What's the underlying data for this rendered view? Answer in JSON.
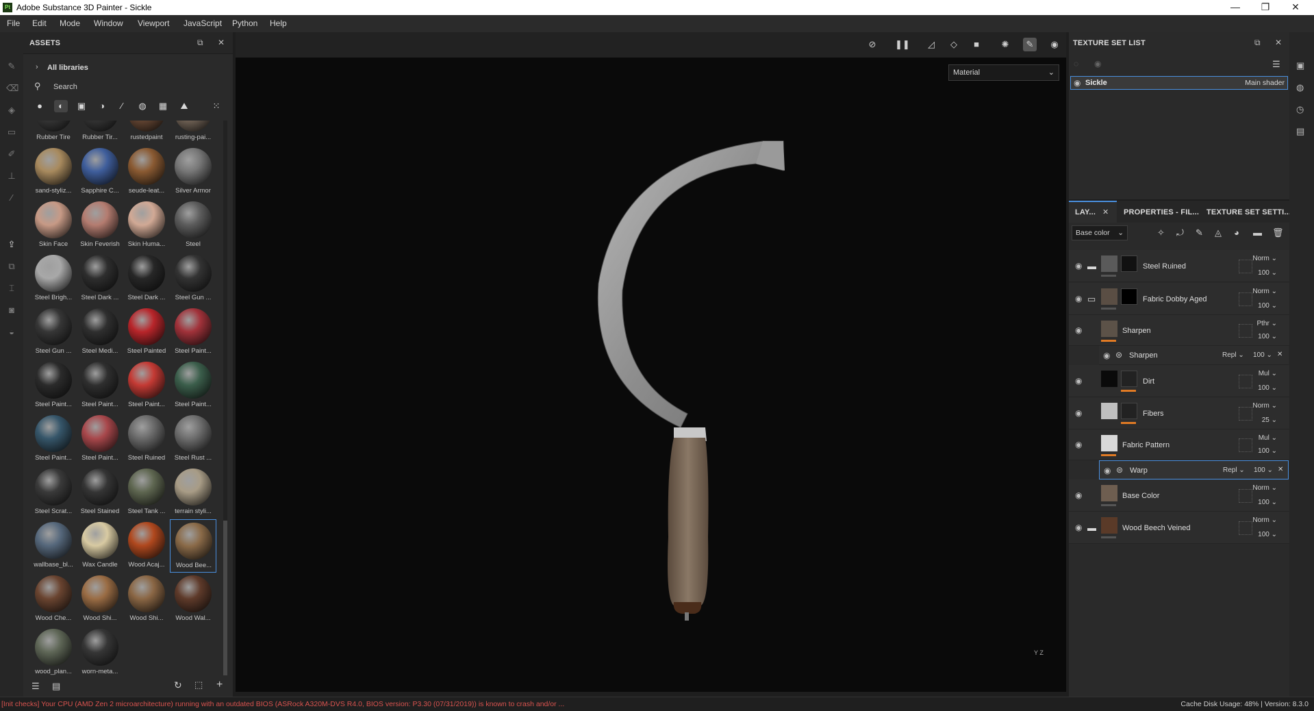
{
  "window": {
    "title": "Adobe Substance 3D Painter - Sickle",
    "app_icon": "Pt"
  },
  "menu": [
    "File",
    "Edit",
    "Mode",
    "Window",
    "Viewport",
    "JavaScript",
    "Python",
    "Help"
  ],
  "assets": {
    "title": "ASSETS",
    "library": "All libraries",
    "search_placeholder": "Search",
    "items": [
      {
        "label": "Rubber Tire",
        "color": "#3a3a3a"
      },
      {
        "label": "Rubber Tir...",
        "color": "#383838"
      },
      {
        "label": "rustedpaint",
        "color": "#6b4a36"
      },
      {
        "label": "rusting-pai...",
        "color": "#7a6a5c"
      },
      {
        "label": "sand-styliz...",
        "color": "#a88a5e"
      },
      {
        "label": "Sapphire C...",
        "color": "#3f5e9c"
      },
      {
        "label": "seude-leat...",
        "color": "#8a5a32"
      },
      {
        "label": "Silver Armor",
        "color": "#777777"
      },
      {
        "label": "Skin Face",
        "color": "#c79a86"
      },
      {
        "label": "Skin Feverish",
        "color": "#b47c70"
      },
      {
        "label": "Skin Huma...",
        "color": "#d1a995"
      },
      {
        "label": "Steel",
        "color": "#5c5c5c"
      },
      {
        "label": "Steel Brigh...",
        "color": "#a8a8a8"
      },
      {
        "label": "Steel Dark ...",
        "color": "#2e2e2e"
      },
      {
        "label": "Steel Dark ...",
        "color": "#272727"
      },
      {
        "label": "Steel Gun ...",
        "color": "#333333"
      },
      {
        "label": "Steel Gun ...",
        "color": "#363636"
      },
      {
        "label": "Steel Medi...",
        "color": "#2f2f2f"
      },
      {
        "label": "Steel Painted",
        "color": "#b8252a"
      },
      {
        "label": "Steel Paint...",
        "color": "#a1323a"
      },
      {
        "label": "Steel Paint...",
        "color": "#2b2b2b"
      },
      {
        "label": "Steel Paint...",
        "color": "#2f2f2f"
      },
      {
        "label": "Steel Paint...",
        "color": "#c43a34"
      },
      {
        "label": "Steel Paint...",
        "color": "#3b5e4b"
      },
      {
        "label": "Steel Paint...",
        "color": "#36566a"
      },
      {
        "label": "Steel Paint...",
        "color": "#a8474b"
      },
      {
        "label": "Steel Ruined",
        "color": "#6a6a6a"
      },
      {
        "label": "Steel Rust ...",
        "color": "#6e6e6e"
      },
      {
        "label": "Steel Scrat...",
        "color": "#3a3a3a"
      },
      {
        "label": "Steel Stained",
        "color": "#353535"
      },
      {
        "label": "Steel Tank ...",
        "color": "#5e6650"
      },
      {
        "label": "terrain styli...",
        "color": "#a89c86"
      },
      {
        "label": "wallbase_bl...",
        "color": "#56687c"
      },
      {
        "label": "Wax Candle",
        "color": "#d8caa2"
      },
      {
        "label": "Wood Acaj...",
        "color": "#b0481e"
      },
      {
        "label": "Wood Bee...",
        "color": "#8a6a48"
      },
      {
        "label": "Wood Che...",
        "color": "#6a4430"
      },
      {
        "label": "Wood Shi...",
        "color": "#9a6c44"
      },
      {
        "label": "Wood Shi...",
        "color": "#8a6644"
      },
      {
        "label": "Wood Wal...",
        "color": "#5e3a2a"
      },
      {
        "label": "wood_plan...",
        "color": "#5e6656"
      },
      {
        "label": "worn-meta...",
        "color": "#363636"
      }
    ]
  },
  "viewport": {
    "mode": "Material",
    "axis": "Y Z"
  },
  "texture_set_list": {
    "title": "TEXTURE SET LIST",
    "set_name": "Sickle",
    "shader": "Main shader"
  },
  "layers": {
    "tabs": [
      "LAY...",
      "PROPERTIES - FIL...",
      "TEXTURE SET SETTI..."
    ],
    "channel": "Base color",
    "rows": [
      {
        "name": "Steel Ruined",
        "blend": "Norm",
        "opacity": "100",
        "kind": "folder",
        "thumb": "#5a5a5a",
        "mask": "#111"
      },
      {
        "name": "Fabric Dobby Aged",
        "blend": "Norm",
        "opacity": "100",
        "kind": "folder-open",
        "thumb": "#5a4e44",
        "mask": "#000"
      },
      {
        "name": "Sharpen",
        "blend": "Pthr",
        "opacity": "100",
        "kind": "fill",
        "thumb": "#5c5248",
        "mask": ""
      },
      {
        "name": "Sharpen",
        "blend": "Repl",
        "opacity": "100",
        "kind": "filter",
        "thumb": "",
        "mask": ""
      },
      {
        "name": "Dirt",
        "blend": "Mul",
        "opacity": "100",
        "kind": "fill",
        "thumb": "#0a0a0a",
        "mask": "#222"
      },
      {
        "name": "Fibers",
        "blend": "Norm",
        "opacity": "25",
        "kind": "fill",
        "thumb": "#bfbfbf",
        "mask": "#222"
      },
      {
        "name": "Fabric Pattern",
        "blend": "Mul",
        "opacity": "100",
        "kind": "fill",
        "thumb": "#d8d8d8",
        "mask": ""
      },
      {
        "name": "Warp",
        "blend": "Repl",
        "opacity": "100",
        "kind": "filter-selected",
        "thumb": "",
        "mask": ""
      },
      {
        "name": "Base Color",
        "blend": "Norm",
        "opacity": "100",
        "kind": "fill",
        "thumb": "#6e5e50",
        "mask": ""
      },
      {
        "name": "Wood Beech Veined",
        "blend": "Norm",
        "opacity": "100",
        "kind": "folder",
        "thumb": "#5a3a28",
        "mask": ""
      }
    ]
  },
  "status": {
    "message": "[Init checks] Your CPU (AMD Zen 2 microarchitecture) running with an outdated BIOS (ASRock A320M-DVS R4.0, BIOS version: P3.30 (07/31/2019)) is known to crash and/or ...",
    "cache": "Cache Disk Usage:   48% | Version: 8.3.0"
  }
}
